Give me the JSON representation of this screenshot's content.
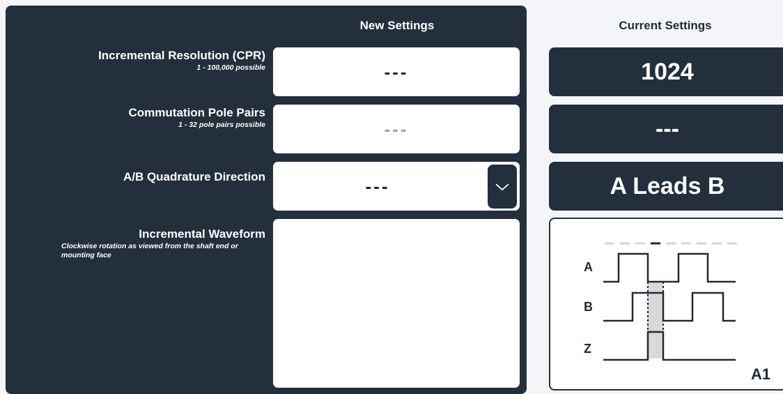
{
  "headers": {
    "new_settings": "New Settings",
    "current_settings": "Current Settings"
  },
  "rows": {
    "resolution": {
      "label": "Incremental Resolution (CPR)",
      "hint": "1 - 100,000 possible",
      "new_value": "---",
      "current_value": "1024"
    },
    "pole_pairs": {
      "label": "Commutation Pole Pairs",
      "hint": "1 - 32 pole pairs possible",
      "new_value": "---",
      "current_value": "---"
    },
    "quadrature": {
      "label": "A/B Quadrature Direction",
      "new_value": "---",
      "current_value": "A Leads B"
    },
    "waveform": {
      "label": "Incremental Waveform",
      "hint": "Clockwise rotation as viewed from the shaft end or mounting face",
      "channels": [
        "A",
        "B",
        "Z"
      ],
      "code": "A1"
    }
  },
  "icons": {
    "dropdown": "chevron-down-icon"
  },
  "colors": {
    "panel": "#232f3c",
    "background": "#f3f5f8",
    "field": "#ffffff",
    "highlight": "#d9d9d9"
  }
}
